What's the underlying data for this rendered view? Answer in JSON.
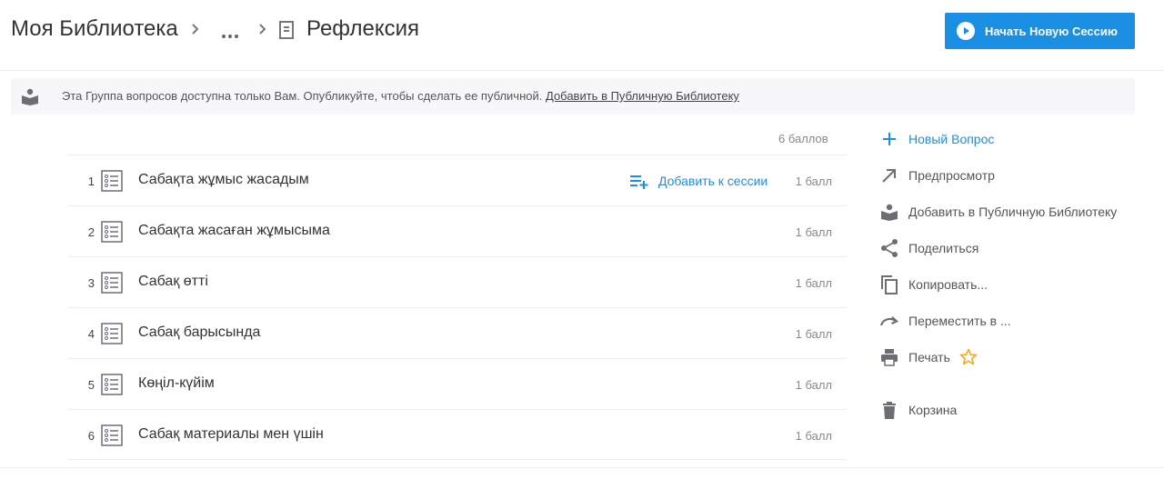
{
  "breadcrumb": {
    "root": "Моя Библиотека",
    "ellipsis": "more-horizontal-icon",
    "title": "Рефлексия"
  },
  "header": {
    "start_button": "Начать Новую Сессию"
  },
  "notice": {
    "text": "Эта Группа вопросов доступна только Вам. Опубликуйте, чтобы сделать ее публичной.",
    "link": "Добавить в Публичную Библиотеку"
  },
  "questions": {
    "total": "6 баллов",
    "add_to_session": "Добавить к сессии",
    "items": [
      {
        "num": "1",
        "text": "Сабақта жұмыс жасадым",
        "points": "1 балл"
      },
      {
        "num": "2",
        "text": "Сабақта жасаған жұмысыма",
        "points": "1 балл"
      },
      {
        "num": "3",
        "text": "Сабақ өтті",
        "points": "1 балл"
      },
      {
        "num": "4",
        "text": "Сабақ барысында",
        "points": "1 балл"
      },
      {
        "num": "5",
        "text": "Көңіл-күйім",
        "points": "1 балл"
      },
      {
        "num": "6",
        "text": "Сабақ материалы мен үшін",
        "points": "1 балл"
      }
    ]
  },
  "sidebar": {
    "new_question": "Новый Вопрос",
    "preview": "Предпросмотр",
    "add_public": "Добавить в Публичную Библиотеку",
    "share": "Поделиться",
    "copy": "Копировать...",
    "move": "Переместить в ...",
    "print": "Печать",
    "trash": "Корзина"
  },
  "colors": {
    "accent": "#1a8fe3",
    "icon_gray": "#6b6f75",
    "star": "#f5a623"
  }
}
